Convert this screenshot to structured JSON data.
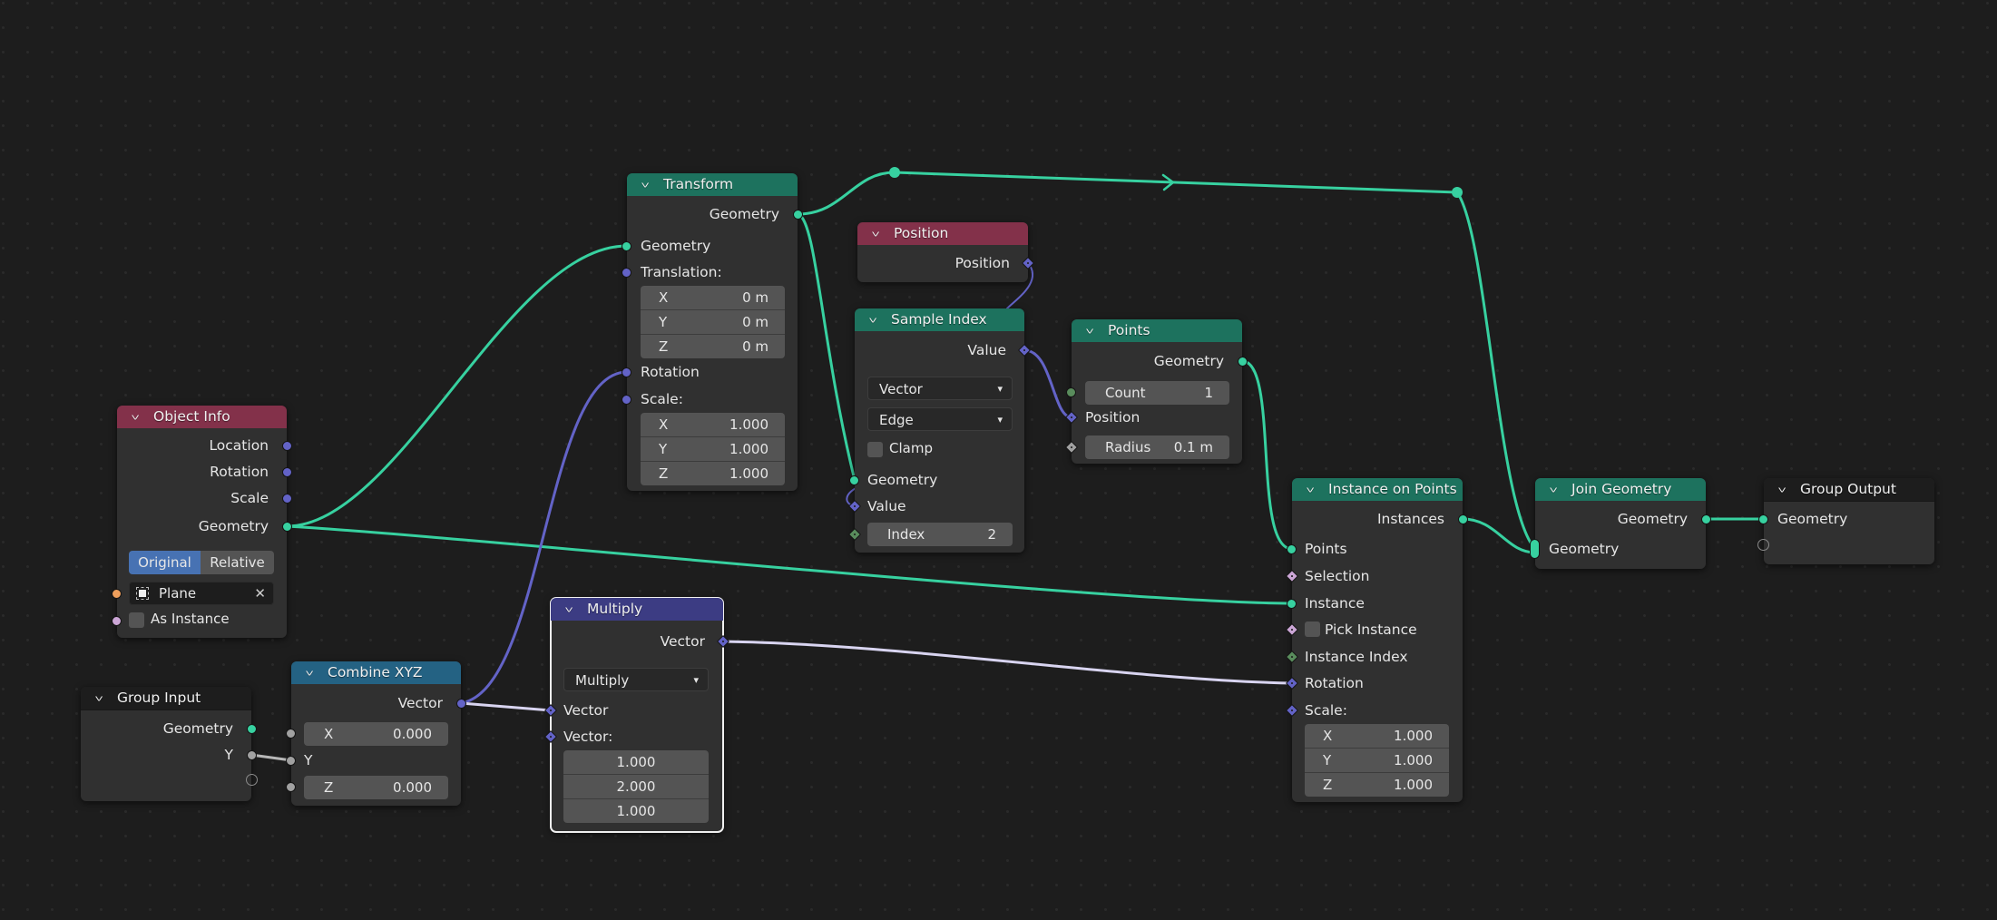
{
  "editor": "Geometry Node Editor",
  "colors": {
    "geometry_socket": "#37d1a0",
    "vector_socket": "#6363c7",
    "float_socket": "#a1a1a1",
    "int_socket": "#598c5c",
    "bool_socket": "#cca6d6",
    "object_socket": "#ed9e5c",
    "header_input": "#83314a",
    "header_geometry": "#1d725e",
    "header_converter": "#246283",
    "header_vector": "#3c3c83",
    "header_group": "#1d1d1d"
  },
  "nodes": {
    "object_info": {
      "title": "Object Info",
      "outputs": [
        "Location",
        "Rotation",
        "Scale",
        "Geometry"
      ],
      "transform_space": {
        "options": [
          "Original",
          "Relative"
        ],
        "selected": "Original"
      },
      "object": {
        "value": "Plane"
      },
      "as_instance": {
        "label": "As Instance",
        "checked": false
      }
    },
    "transform": {
      "title": "Transform",
      "output": "Geometry",
      "inputs": {
        "geometry": "Geometry",
        "translation": "Translation:",
        "rotation": "Rotation",
        "scale": "Scale:"
      },
      "translation": [
        {
          "axis": "X",
          "value": "0 m"
        },
        {
          "axis": "Y",
          "value": "0 m"
        },
        {
          "axis": "Z",
          "value": "0 m"
        }
      ],
      "scale": [
        {
          "axis": "X",
          "value": "1.000"
        },
        {
          "axis": "Y",
          "value": "1.000"
        },
        {
          "axis": "Z",
          "value": "1.000"
        }
      ]
    },
    "position": {
      "title": "Position",
      "output": "Position"
    },
    "sample_index": {
      "title": "Sample Index",
      "output": "Value",
      "data_type": "Vector",
      "domain": "Edge",
      "clamp": {
        "label": "Clamp",
        "checked": false
      },
      "inputs": {
        "geometry": "Geometry",
        "value": "Value"
      },
      "index": {
        "label": "Index",
        "value": "2"
      }
    },
    "points": {
      "title": "Points",
      "output": "Geometry",
      "count": {
        "label": "Count",
        "value": "1"
      },
      "position_label": "Position",
      "radius": {
        "label": "Radius",
        "value": "0.1 m"
      }
    },
    "instance_on_points": {
      "title": "Instance on Points",
      "output": "Instances",
      "inputs": [
        "Points",
        "Selection",
        "Instance",
        "Pick Instance",
        "Instance Index",
        "Rotation",
        "Scale:"
      ],
      "pick_instance_checked": false,
      "scale": [
        {
          "axis": "X",
          "value": "1.000"
        },
        {
          "axis": "Y",
          "value": "1.000"
        },
        {
          "axis": "Z",
          "value": "1.000"
        }
      ]
    },
    "join_geometry": {
      "title": "Join Geometry",
      "output": "Geometry",
      "input": "Geometry"
    },
    "group_output": {
      "title": "Group Output",
      "input": "Geometry"
    },
    "group_input": {
      "title": "Group Input",
      "outputs": [
        "Geometry",
        "Y"
      ]
    },
    "combine_xyz": {
      "title": "Combine XYZ",
      "output": "Vector",
      "x": {
        "label": "X",
        "value": "0.000"
      },
      "y_label": "Y",
      "z": {
        "label": "Z",
        "value": "0.000"
      }
    },
    "multiply": {
      "title": "Multiply",
      "output": "Vector",
      "operation": "Multiply",
      "inputs": [
        "Vector",
        "Vector:"
      ],
      "vector_values": [
        "1.000",
        "2.000",
        "1.000"
      ],
      "selected": true
    }
  },
  "links": [
    {
      "from": "Object Info.Geometry",
      "to": "Transform.Geometry",
      "type": "geometry"
    },
    {
      "from": "Object Info.Geometry",
      "to": "Instance on Points.Instance",
      "type": "geometry"
    },
    {
      "from": "Transform.Geometry",
      "to": "Sample Index.Geometry",
      "type": "geometry"
    },
    {
      "from": "Transform.Geometry",
      "to": "Join Geometry.Geometry",
      "type": "geometry",
      "via_reroutes": 2
    },
    {
      "from": "Position.Position",
      "to": "Sample Index.Value",
      "type": "vector"
    },
    {
      "from": "Sample Index.Value",
      "to": "Points.Position",
      "type": "vector"
    },
    {
      "from": "Points.Geometry",
      "to": "Instance on Points.Points",
      "type": "geometry"
    },
    {
      "from": "Instance on Points.Instances",
      "to": "Join Geometry.Geometry",
      "type": "geometry"
    },
    {
      "from": "Join Geometry.Geometry",
      "to": "Group Output.Geometry",
      "type": "geometry"
    },
    {
      "from": "Group Input.Y",
      "to": "Combine XYZ.Y",
      "type": "float"
    },
    {
      "from": "Combine XYZ.Vector",
      "to": "Transform.Rotation",
      "type": "vector"
    },
    {
      "from": "Combine XYZ.Vector",
      "to": "Multiply.Vector",
      "type": "vector",
      "highlighted": true
    },
    {
      "from": "Multiply.Vector",
      "to": "Instance on Points.Rotation",
      "type": "vector",
      "highlighted": true
    }
  ]
}
